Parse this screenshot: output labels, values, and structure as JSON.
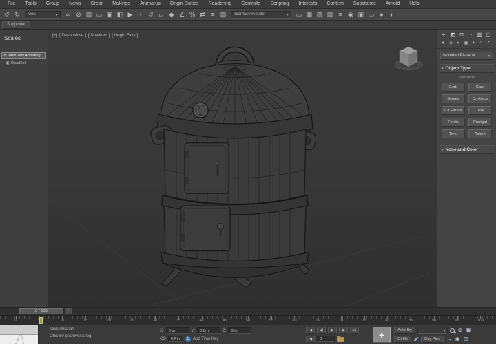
{
  "menu": {
    "items": [
      "File",
      "Tools",
      "Group",
      "News",
      "Crear",
      "Makings",
      "Animarus",
      "Origin Enities",
      "Readening",
      "Contralts",
      "Scripting",
      "Interests",
      "Contem",
      "Substance",
      "Arnold",
      "Help"
    ]
  },
  "toolbar": {
    "filter_dropdown": "Meu",
    "sets_dropdown": "ocer fastrevander",
    "icons_a": [
      {
        "name": "undo-icon",
        "glyph": "↺"
      },
      {
        "name": "redo-icon",
        "glyph": "↻"
      }
    ],
    "icons_b": [
      {
        "name": "select-link-icon",
        "glyph": "∞"
      },
      {
        "name": "unlink-icon",
        "glyph": "⊘"
      },
      {
        "name": "select-by-name-icon",
        "glyph": "▤"
      },
      {
        "name": "rect-region-icon",
        "glyph": "▭"
      },
      {
        "name": "crossing-selection-icon",
        "glyph": "▣"
      },
      {
        "name": "window-selection-icon",
        "glyph": "◧"
      },
      {
        "name": "select-object-icon",
        "glyph": "▶"
      },
      {
        "name": "move-icon",
        "glyph": "+"
      },
      {
        "name": "rotate-icon",
        "glyph": "↺"
      },
      {
        "name": "scale-icon",
        "glyph": "▱"
      },
      {
        "name": "snap-toggle-icon",
        "glyph": "◆"
      },
      {
        "name": "angle-snap-icon",
        "glyph": "∠"
      },
      {
        "name": "percent-snap-icon",
        "glyph": "%"
      },
      {
        "name": "mirror-icon",
        "glyph": "⇄"
      },
      {
        "name": "align-icon",
        "glyph": "≡"
      },
      {
        "name": "layers-icon",
        "glyph": "▤"
      }
    ],
    "icons_c": [
      {
        "name": "toggle-ribbon-icon",
        "glyph": "▭"
      },
      {
        "name": "curve-editor-icon",
        "glyph": "▦"
      },
      {
        "name": "schematic-view-icon",
        "glyph": "▨"
      },
      {
        "name": "scene-explorer-icon",
        "glyph": "▤"
      },
      {
        "name": "layer-explorer-icon",
        "glyph": "≡"
      },
      {
        "name": "material-editor-icon",
        "glyph": "◉"
      },
      {
        "name": "render-setup-icon",
        "glyph": "▣"
      },
      {
        "name": "rendered-frame-icon",
        "glyph": "▭"
      },
      {
        "name": "render-production-icon",
        "glyph": "●"
      },
      {
        "name": "render-iterative-icon",
        "glyph": "◐"
      }
    ]
  },
  "subbar": {
    "label": "Suppional"
  },
  "left_panel": {
    "title": "Scales",
    "rows": [
      {
        "label": "Id TomsUket Anreding"
      },
      {
        "label": "Opad2oll"
      }
    ]
  },
  "viewport": {
    "labels": [
      "[+]",
      "[ Despositive ]",
      "[ Nowifred ]",
      "[ Ungid Ficts ]"
    ]
  },
  "command_panel": {
    "tabs": [
      {
        "name": "create-tab-icon",
        "glyph": "+"
      },
      {
        "name": "modify-tab-icon",
        "glyph": "◩"
      },
      {
        "name": "hierarchy-tab-icon",
        "glyph": "⊓"
      },
      {
        "name": "motion-tab-icon",
        "glyph": "◔"
      },
      {
        "name": "display-tab-icon",
        "glyph": "▥"
      },
      {
        "name": "utilities-tab-icon",
        "glyph": "▢"
      }
    ],
    "categories": [
      {
        "name": "geometry-category-icon",
        "glyph": "●"
      },
      {
        "name": "shapes-category-icon",
        "glyph": "S"
      },
      {
        "name": "lights-category-icon",
        "glyph": "◐"
      },
      {
        "name": "cameras-category-icon",
        "glyph": "▣"
      },
      {
        "name": "helpers-category-icon",
        "glyph": "+"
      },
      {
        "name": "spacewarps-category-icon",
        "glyph": "≈"
      },
      {
        "name": "systems-category-icon",
        "glyph": "*"
      }
    ],
    "dropdown": "Iscreded Pisnarar",
    "object_type_header": "Object Type",
    "autogrid_label": "Plerisone",
    "buttons": [
      "Ecrt.",
      "Care",
      "Swees",
      "Cristiecs",
      "Ca Farete",
      "Tese",
      "Findis",
      "Puntgat",
      "Tield",
      "Talent"
    ],
    "name_color_header": "None and Color"
  },
  "timeline": {
    "slider": "0 / 100",
    "next_label": "›",
    "ticks": [
      "0",
      "5",
      "10",
      "15",
      "20",
      "25",
      "30",
      "35",
      "40",
      "45",
      "50",
      "55",
      "60",
      "65",
      "70",
      "75",
      "80",
      "85",
      "90",
      "95",
      "100"
    ]
  },
  "status": {
    "line1": "Mwe rmiatiad",
    "line2": "Otks 50 posmvesic.ieg",
    "coords": [
      {
        "label": "X:",
        "value": "0 un"
      },
      {
        "label": "Y:",
        "value": "0.8m"
      },
      {
        "label": "Z:",
        "value": "0 im"
      }
    ],
    "grid_label": "CO",
    "grid_value": "0 Pin",
    "add_time_tag": "Aod Time Kay",
    "frame": "0",
    "transport": [
      {
        "name": "go-start-icon",
        "glyph": "|◀"
      },
      {
        "name": "prev-frame-icon",
        "glyph": "◀|"
      },
      {
        "name": "play-icon",
        "glyph": "▶"
      },
      {
        "name": "next-frame-icon",
        "glyph": "|▶"
      },
      {
        "name": "go-end-icon",
        "glyph": "▶|"
      }
    ],
    "key_plus": "+",
    "auto_key": "Auto Iky",
    "set_key": "Ot He",
    "key_filters": "Day Fies",
    "nav1": [
      {
        "name": "zoom-icon",
        "glyph": "⊕"
      },
      {
        "name": "zoom-extents-icon",
        "glyph": "▣"
      }
    ],
    "nav2": [
      {
        "name": "pan-icon",
        "glyph": "↔"
      },
      {
        "name": "orbit-icon",
        "glyph": "◉"
      },
      {
        "name": "maximize-viewport-icon",
        "glyph": "⊡"
      }
    ]
  }
}
